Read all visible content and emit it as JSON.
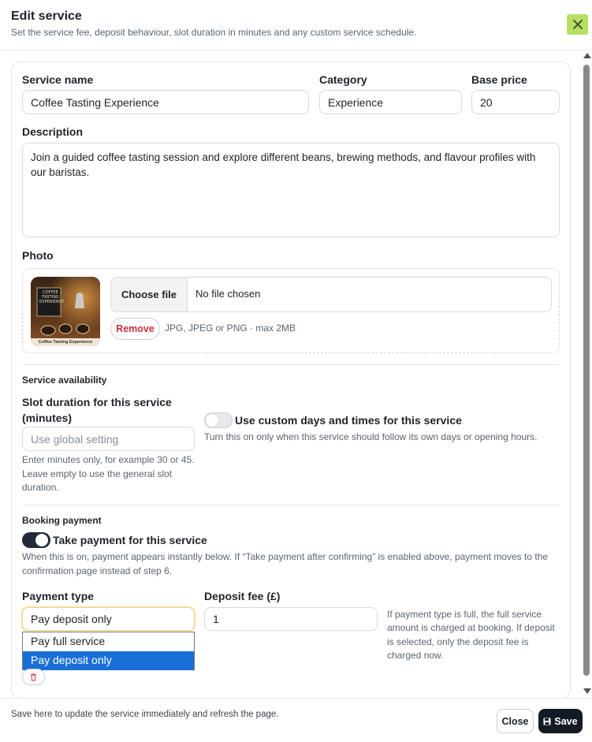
{
  "header": {
    "title": "Edit service",
    "subtitle": "Set the service fee, deposit behaviour, slot duration in minutes and any custom service schedule.",
    "close_icon": "close-icon",
    "close_color": "#b5e063"
  },
  "form": {
    "service_name": {
      "label": "Service name",
      "value": "Coffee Tasting Experience"
    },
    "category": {
      "label": "Category",
      "value": "Experience"
    },
    "base_price": {
      "label": "Base price",
      "value": "20"
    },
    "description": {
      "label": "Description",
      "value": "Join a guided coffee tasting session and explore different beans, brewing methods, and flavour profiles with our baristas."
    },
    "photo": {
      "label": "Photo",
      "thumb_caption": "Coffee Tasting Experience",
      "thumb_sign": "COFFEE TASTING EXPERIENCE",
      "choose_label": "Choose file",
      "status": "No file chosen",
      "remove_label": "Remove",
      "hint": "JPG, JPEG or PNG · max 2MB"
    },
    "availability": {
      "section_label": "Service availability",
      "slot_label": "Slot duration for this service (minutes)",
      "slot_placeholder": "Use global setting",
      "slot_help": "Enter minutes only, for example 30 or 45. Leave empty to use the general slot duration.",
      "custom_toggle_label": "Use custom days and times for this service",
      "custom_toggle_on": false,
      "custom_help": "Turn this on only when this service should follow its own days or opening hours."
    },
    "payment": {
      "section_label": "Booking payment",
      "take_payment_label": "Take payment for this service",
      "take_payment_on": true,
      "take_payment_help": "When this is on, payment appears instantly below. If “Take payment after confirming” is enabled above, payment moves to the confirmation page instead of step 6.",
      "type_label": "Payment type",
      "type_value": "Pay deposit only",
      "type_options": [
        "Pay full service",
        "Pay deposit only"
      ],
      "deposit_label": "Deposit fee (£)",
      "deposit_value": "1",
      "deposit_help": "If payment type is full, the full service amount is charged at booking. If deposit is selected, only the deposit fee is charged now."
    }
  },
  "footer": {
    "note": "Save here to update the service immediately and refresh the page.",
    "close_label": "Close",
    "save_label": "Save",
    "save_icon": "floppy-disk-icon"
  },
  "colors": {
    "accent_dark": "#121a26",
    "danger": "#c8313a",
    "selected_option": "#1a6fd6"
  }
}
